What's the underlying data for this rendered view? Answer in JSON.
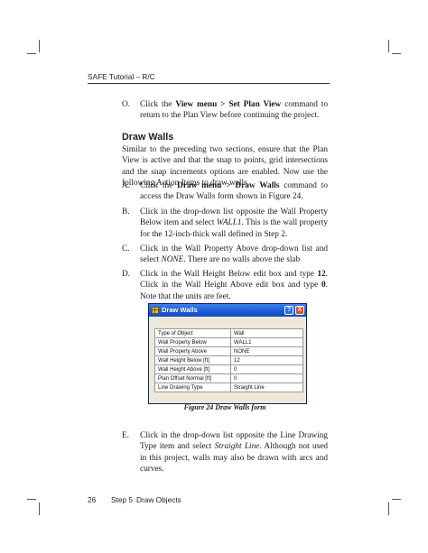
{
  "header": {
    "running_title": "SAFE Tutorial – R/C"
  },
  "item_o": {
    "letter": "O.",
    "pre": "Click the ",
    "bold": "View menu > Set Plan View",
    "post": " command to return to the Plan View before continuing the project."
  },
  "section": {
    "title": "Draw Walls",
    "intro": "Similar to the preceding two sections, ensure that the Plan View is active and that the snap to points, grid intersections and the snap increments options are enabled. Now use the following Action Items to draw walls."
  },
  "item_a": {
    "letter": "A.",
    "pre": "Click the ",
    "bold": "Draw menu > Draw Walls",
    "post": " command to access the Draw Walls form shown in Figure 24."
  },
  "item_b": {
    "letter": "B.",
    "pre": "Click in the drop-down list opposite the Wall Property Below item and select ",
    "italic": "WALL1",
    "post": ". This is the wall property for the 12-inch-thick wall defined in Step 2."
  },
  "item_c": {
    "letter": "C.",
    "pre": "Click in the Wall Property Above drop-down list and select ",
    "italic": "NONE",
    "post": ". There are no walls above the slab"
  },
  "item_d": {
    "letter": "D.",
    "pre": "Click in the Wall Height Below edit box and type ",
    "bold1": "12",
    "mid": ". Click in the Wall Height Above edit box and type ",
    "bold2": "0",
    "post": ".  Note that the units are feet."
  },
  "dialog": {
    "title": "Draw Walls",
    "help_glyph": "?",
    "close_glyph": "X",
    "rows": [
      {
        "name": "Type of Object",
        "value": "Wall"
      },
      {
        "name": "Wall Property Below",
        "value": "WALL1"
      },
      {
        "name": "Wall Property Above",
        "value": "NONE"
      },
      {
        "name": "Wall Height Below  [ft]",
        "value": "12"
      },
      {
        "name": "Wall Height Above  [ft]",
        "value": "0"
      },
      {
        "name": "Plan Offset Normal  [ft]",
        "value": "0"
      },
      {
        "name": "Line Drawing Type",
        "value": "Straight Line"
      }
    ]
  },
  "caption": "Figure 24 Draw Walls form",
  "item_e": {
    "letter": "E.",
    "pre": "Click in the drop-down list opposite the Line Drawing Type item and select ",
    "italic": "Straight Line",
    "post": ".  Although not used in this project, walls may also be drawn with arcs and curves."
  },
  "footer": {
    "page_number": "26",
    "step": "Step 5",
    "chapter": "Draw Objects"
  }
}
